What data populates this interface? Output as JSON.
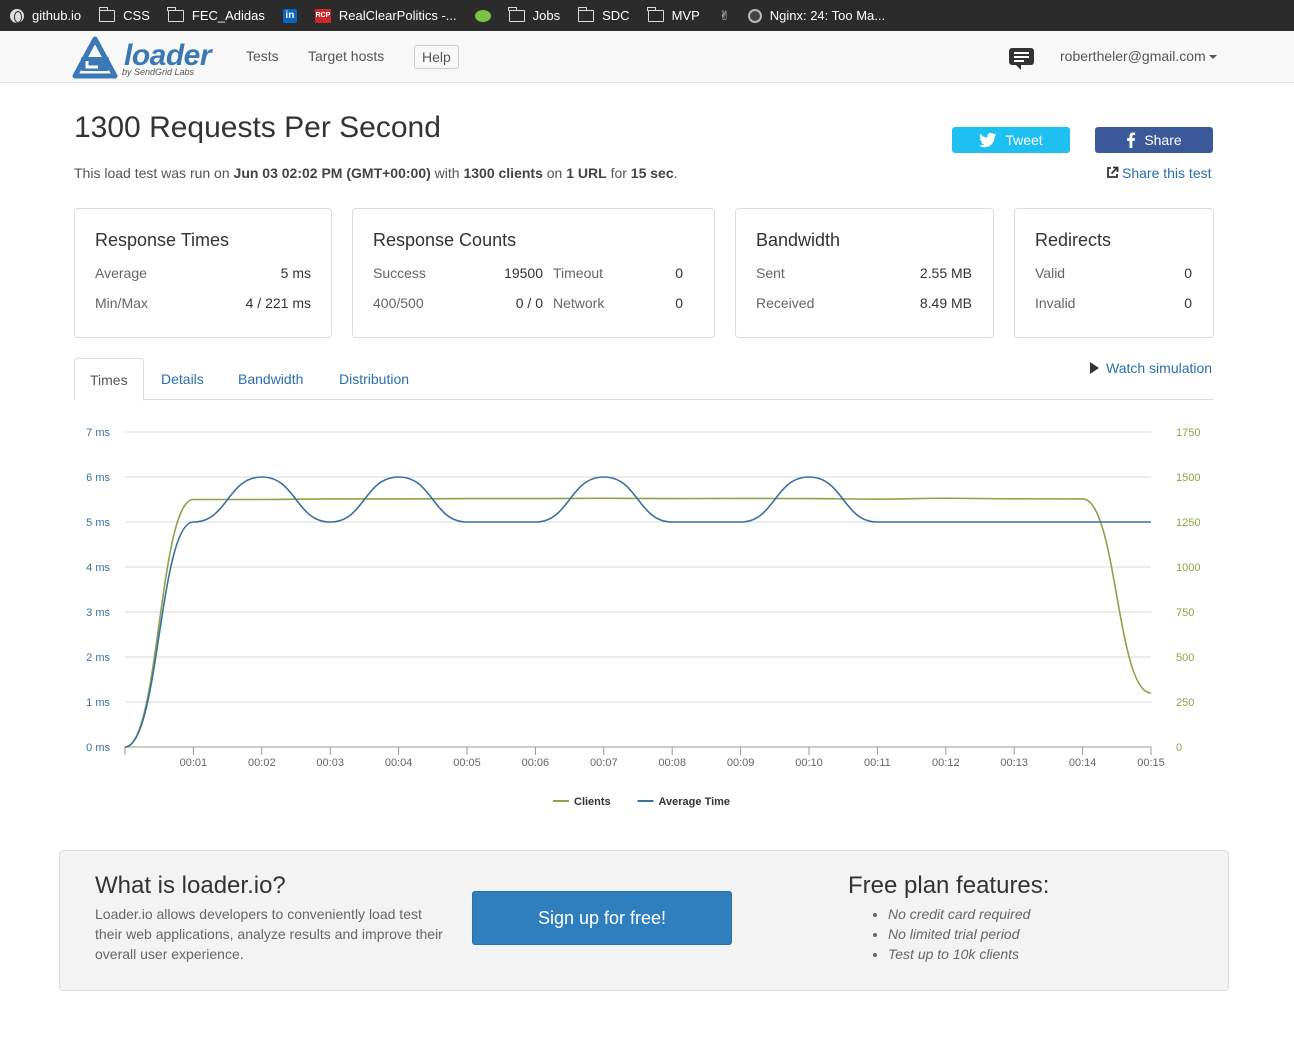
{
  "bookmarks": [
    {
      "label": "github.io",
      "icon": "globe-icon"
    },
    {
      "label": "CSS",
      "icon": "folder-icon"
    },
    {
      "label": "FEC_Adidas",
      "icon": "folder-icon"
    },
    {
      "label": "",
      "icon": "linkedin-icon"
    },
    {
      "label": "RealClearPolitics -...",
      "icon": "rcp-icon"
    },
    {
      "label": "",
      "icon": "lime-icon"
    },
    {
      "label": "Jobs",
      "icon": "folder-icon"
    },
    {
      "label": "SDC",
      "icon": "folder-icon"
    },
    {
      "label": "MVP",
      "icon": "folder-icon"
    },
    {
      "label": "",
      "icon": "peace-icon"
    },
    {
      "label": "Nginx: 24: Too Ma...",
      "icon": "nginx-icon"
    }
  ],
  "brand": {
    "name": "loader",
    "subtitle": "by SendGrid Labs",
    "color": "#3a79b6"
  },
  "nav": {
    "tests": "Tests",
    "target_hosts": "Target hosts",
    "help": "Help",
    "user_email": "robertheler@gmail.com"
  },
  "header": {
    "title": "1300 Requests Per Second",
    "summary": {
      "prefix": "This load test was run on",
      "date": "Jun 03 02:02 PM (GMT+00:00)",
      "with": "with",
      "clients": "1300 clients",
      "on": "on",
      "urls": "1 URL",
      "for": "for",
      "duration": "15 sec",
      "end": "."
    },
    "tweet": "Tweet",
    "share": "Share",
    "share_test": "Share this test"
  },
  "cards": {
    "response_times": {
      "title": "Response Times",
      "average_label": "Average",
      "average": "5 ms",
      "minmax_label": "Min/Max",
      "minmax": "4 / 221 ms"
    },
    "response_counts": {
      "title": "Response Counts",
      "success_label": "Success",
      "success": "19500",
      "timeout_label": "Timeout",
      "timeout": "0",
      "errors_label": "400/500",
      "errors": "0 / 0",
      "network_label": "Network",
      "network": "0"
    },
    "bandwidth": {
      "title": "Bandwidth",
      "sent_label": "Sent",
      "sent": "2.55 MB",
      "received_label": "Received",
      "received": "8.49 MB"
    },
    "redirects": {
      "title": "Redirects",
      "valid_label": "Valid",
      "valid": "0",
      "invalid_label": "Invalid",
      "invalid": "0"
    }
  },
  "tabs": [
    "Times",
    "Details",
    "Bandwidth",
    "Distribution"
  ],
  "active_tab": "Times",
  "watch_simulation": "Watch simulation",
  "chart_data": {
    "type": "line",
    "x": [
      "00:00",
      "00:01",
      "00:02",
      "00:03",
      "00:04",
      "00:05",
      "00:06",
      "00:07",
      "00:08",
      "00:09",
      "00:10",
      "00:11",
      "00:12",
      "00:13",
      "00:14",
      "00:15"
    ],
    "x_tick_labels": [
      "00:01",
      "00:02",
      "00:03",
      "00:04",
      "00:05",
      "00:06",
      "00:07",
      "00:08",
      "00:09",
      "00:10",
      "00:11",
      "00:12",
      "00:13",
      "00:14",
      "00:15"
    ],
    "y_left_ticks": [
      "0 ms",
      "1 ms",
      "2 ms",
      "3 ms",
      "4 ms",
      "5 ms",
      "6 ms",
      "7 ms"
    ],
    "y_right_ticks": [
      "0",
      "250",
      "500",
      "750",
      "1000",
      "1250",
      "1500",
      "1750"
    ],
    "y_left_range": [
      0,
      7
    ],
    "y_right_range": [
      0,
      1750
    ],
    "grid": true,
    "legend_position": "bottom-center",
    "series": [
      {
        "name": "Clients",
        "axis": "right",
        "color": "#8ba44b",
        "values": [
          0,
          1375,
          1375,
          1378,
          1378,
          1380,
          1380,
          1382,
          1380,
          1381,
          1380,
          1377,
          1382,
          1379,
          1378,
          300
        ]
      },
      {
        "name": "Average Time",
        "axis": "left",
        "color": "#3e6f9f",
        "values": [
          0,
          5,
          6,
          5,
          6,
          5,
          5,
          6,
          5,
          5,
          6,
          5,
          5,
          5,
          5,
          5
        ]
      }
    ]
  },
  "promo": {
    "title": "What is loader.io?",
    "description": "Loader.io allows developers to conveniently load test their web applications, analyze results and improve their overall user experience.",
    "signup": "Sign up for free!",
    "features_title": "Free plan features:",
    "features": [
      "No credit card required",
      "No limited trial period",
      "Test up to 10k clients"
    ]
  }
}
